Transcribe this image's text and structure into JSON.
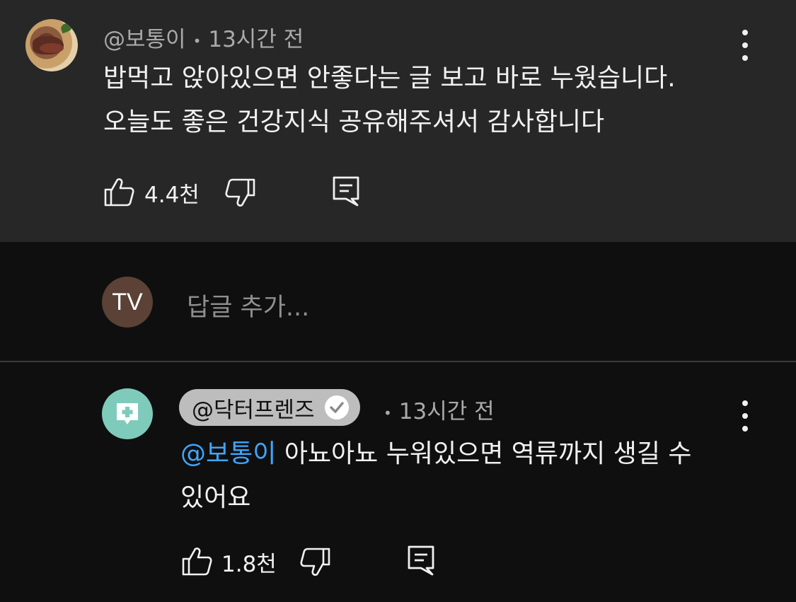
{
  "comment": {
    "author": "@보통이",
    "time": "13시간 전",
    "lines": [
      "밥먹고 앉아있으면 안좋다는 글 보고 바로 누웠습니다.",
      "오늘도 좋은 건강지식 공유해주셔서 감사합니다"
    ],
    "likes": "4.4천"
  },
  "reply_box": {
    "avatar_initials": "TV",
    "placeholder": "답글 추가..."
  },
  "reply": {
    "author": "@닥터프렌즈",
    "time": "13시간 전",
    "mention": "@보통이",
    "line1": " 아뇨아뇨 누워있으면 역류까지 생길 수",
    "line2": "있어요",
    "likes": "1.8천"
  },
  "icons": [
    "like-icon",
    "dislike-icon",
    "reply-icon",
    "more-options-icon",
    "verified-check-icon"
  ],
  "colors": {
    "background": "#0f0f0f",
    "highlight_background": "#272727",
    "mention": "#3ea6ff",
    "secondary_text": "#aaaaaa",
    "doctor_avatar": "#7ecbbc"
  }
}
